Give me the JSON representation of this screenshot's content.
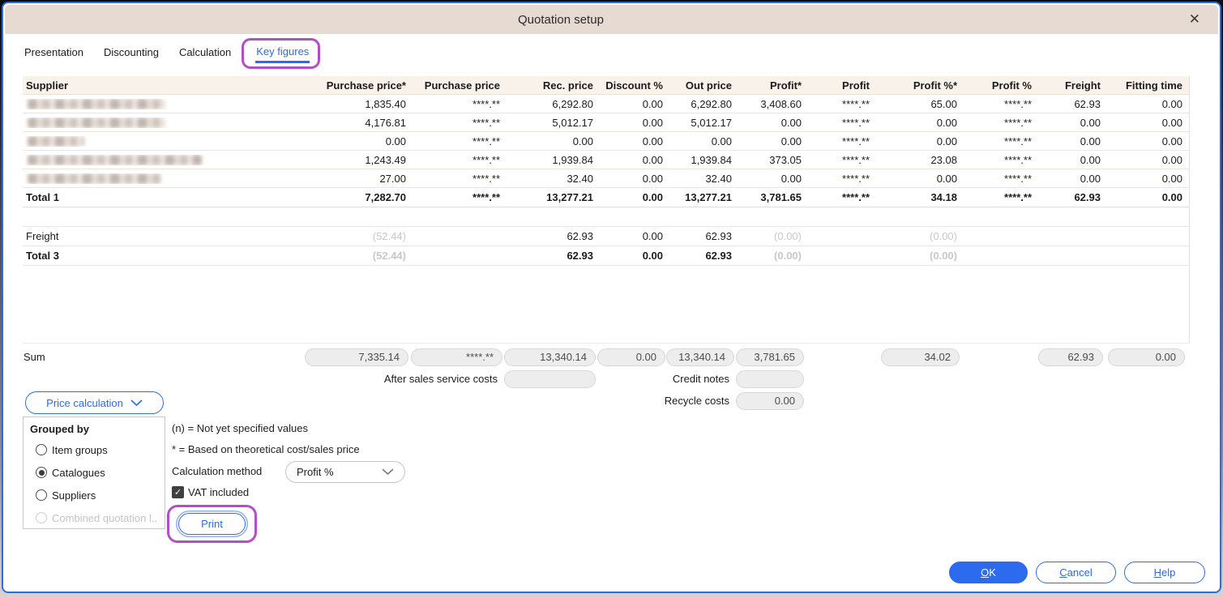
{
  "window": {
    "title": "Quotation setup",
    "close_icon": "✕"
  },
  "tabs": {
    "items": [
      {
        "label": "Presentation",
        "active": false
      },
      {
        "label": "Discounting",
        "active": false
      },
      {
        "label": "Calculation",
        "active": false
      },
      {
        "label": "Key figures",
        "active": true,
        "annotated": true
      }
    ]
  },
  "table": {
    "columns": [
      "Supplier",
      "Purchase price*",
      "Purchase price",
      "Rec. price",
      "Discount %",
      "Out price",
      "Profit*",
      "Profit",
      "Profit %*",
      "Profit %",
      "Freight",
      "Fitting time"
    ],
    "rows": [
      {
        "supplier_redacted": true,
        "redacted_width": 170,
        "values": [
          "1,835.40",
          "****.**",
          "6,292.80",
          "0.00",
          "6,292.80",
          "3,408.60",
          "****.**",
          "65.00",
          "****.**",
          "62.93",
          "0.00"
        ]
      },
      {
        "supplier_redacted": true,
        "redacted_width": 170,
        "values": [
          "4,176.81",
          "****.**",
          "5,012.17",
          "0.00",
          "5,012.17",
          "0.00",
          "****.**",
          "0.00",
          "****.**",
          "0.00",
          "0.00"
        ]
      },
      {
        "supplier_redacted": true,
        "redacted_width": 70,
        "values": [
          "0.00",
          "****.**",
          "0.00",
          "0.00",
          "0.00",
          "0.00",
          "****.**",
          "0.00",
          "****.**",
          "0.00",
          "0.00"
        ]
      },
      {
        "supplier_redacted": true,
        "redacted_width": 215,
        "values": [
          "1,243.49",
          "****.**",
          "1,939.84",
          "0.00",
          "1,939.84",
          "373.05",
          "****.**",
          "23.08",
          "****.**",
          "0.00",
          "0.00"
        ]
      },
      {
        "supplier_redacted": true,
        "redacted_width": 165,
        "values": [
          "27.00",
          "****.**",
          "32.40",
          "0.00",
          "32.40",
          "0.00",
          "****.**",
          "0.00",
          "****.**",
          "0.00",
          "0.00"
        ]
      }
    ],
    "total_rows": [
      {
        "label": "Total 1",
        "bold": true,
        "values": [
          "7,282.70",
          "****.**",
          "13,277.21",
          "0.00",
          "13,277.21",
          "3,781.65",
          "****.**",
          "34.18",
          "****.**",
          "62.93",
          "0.00"
        ]
      }
    ],
    "extra_rows": [
      {
        "label": "Freight",
        "bold": false,
        "values": [
          "(52.44)",
          "",
          "62.93",
          "0.00",
          "62.93",
          "(0.00)",
          "",
          "(0.00)",
          "",
          "",
          ""
        ]
      },
      {
        "label": "Total 3",
        "bold": true,
        "values": [
          "(52.44)",
          "",
          "62.93",
          "0.00",
          "62.93",
          "(0.00)",
          "",
          "(0.00)",
          "",
          "",
          ""
        ]
      }
    ]
  },
  "sum_section": {
    "label": "Sum",
    "pills": [
      "7,335.14",
      "****.**",
      "13,340.14",
      "0.00",
      "13,340.14",
      "3,781.65",
      null,
      "34.02",
      null,
      "62.93",
      "0.00"
    ],
    "after_sales": {
      "label": "After sales service costs",
      "value": ""
    },
    "credit_notes": {
      "label": "Credit notes",
      "value": ""
    },
    "recycle_costs": {
      "label": "Recycle costs",
      "value": "0.00"
    }
  },
  "price_calculation_button": {
    "label": "Price calculation",
    "icon": "chevron-down"
  },
  "grouped_by": {
    "title": "Grouped by",
    "options": [
      {
        "label": "Item groups",
        "selected": false,
        "disabled": false
      },
      {
        "label": "Catalogues",
        "selected": true,
        "disabled": false
      },
      {
        "label": "Suppliers",
        "selected": false,
        "disabled": false
      },
      {
        "label": "Combined quotation l...",
        "selected": false,
        "disabled": true
      }
    ]
  },
  "legend": {
    "line1": "(n) = Not yet specified values",
    "line2": "* = Based on theoretical cost/sales price"
  },
  "calculation_method": {
    "label": "Calculation method",
    "value": "Profit %",
    "icon": "chevron-down"
  },
  "vat_checkbox": {
    "label": "VAT included",
    "checked": true,
    "check_icon": "✓"
  },
  "print_button": {
    "label": "Print"
  },
  "footer": {
    "ok": "OK",
    "cancel": "Cancel",
    "help": "Help"
  },
  "colors": {
    "accent": "#2c6bed",
    "annotation": "#b44dc7",
    "titlebar": "#e7dad2",
    "table_header_bg": "#f9f2ea",
    "disabled_text": "#c8c8c8"
  }
}
